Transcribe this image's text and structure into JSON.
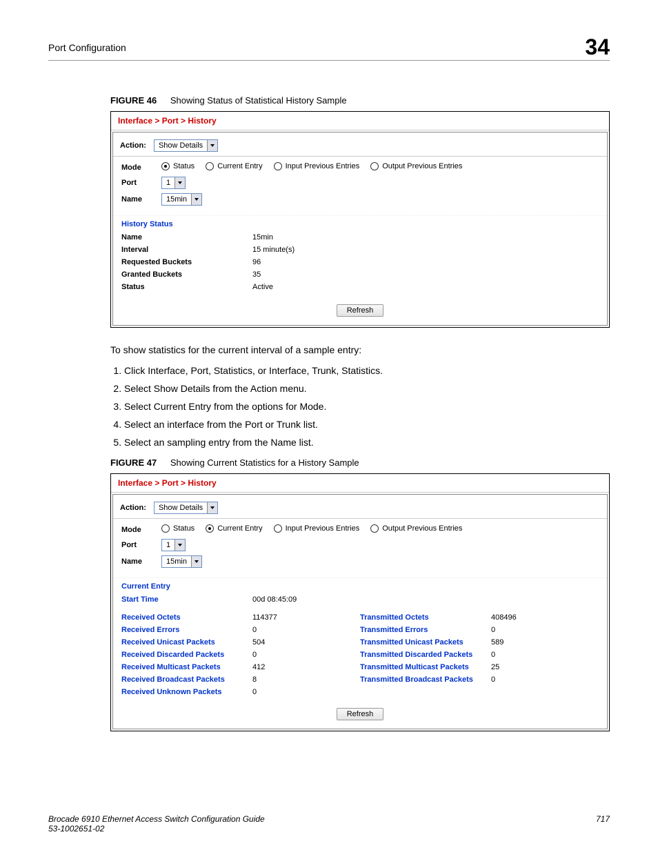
{
  "header": {
    "section": "Port Configuration",
    "chapter": "34"
  },
  "figure46": {
    "label": "FIGURE 46",
    "caption": "Showing Status of Statistical History Sample",
    "breadcrumb": "Interface > Port > History",
    "action_label": "Action:",
    "action_value": "Show Details",
    "mode_label": "Mode",
    "mode_options": [
      "Status",
      "Current Entry",
      "Input Previous Entries",
      "Output Previous Entries"
    ],
    "mode_selected": 0,
    "port_label": "Port",
    "port_value": "1",
    "name_label": "Name",
    "name_value": "15min",
    "section_head": "History Status",
    "rows": [
      {
        "label": "Name",
        "value": "15min"
      },
      {
        "label": "Interval",
        "value": "15 minute(s)"
      },
      {
        "label": "Requested Buckets",
        "value": "96"
      },
      {
        "label": "Granted Buckets",
        "value": "35"
      },
      {
        "label": "Status",
        "value": "Active"
      }
    ],
    "refresh": "Refresh"
  },
  "intro2": "To show statistics for the current interval of a sample entry:",
  "steps": [
    "Click Interface, Port, Statistics, or Interface, Trunk, Statistics.",
    "Select Show Details from the Action menu.",
    "Select Current Entry from the options for Mode.",
    "Select an interface from the Port or Trunk list.",
    "Select an sampling entry from the Name list."
  ],
  "figure47": {
    "label": "FIGURE 47",
    "caption": "Showing Current Statistics for a History Sample",
    "breadcrumb": "Interface > Port > History",
    "action_label": "Action:",
    "action_value": "Show Details",
    "mode_label": "Mode",
    "mode_options": [
      "Status",
      "Current Entry",
      "Input Previous Entries",
      "Output Previous Entries"
    ],
    "mode_selected": 1,
    "port_label": "Port",
    "port_value": "1",
    "name_label": "Name",
    "name_value": "15min",
    "section_head": "Current Entry",
    "start_time_label": "Start Time",
    "start_time_value": "00d 08:45:09",
    "left_stats": [
      {
        "label": "Received Octets",
        "value": "114377"
      },
      {
        "label": "Received Errors",
        "value": "0"
      },
      {
        "label": "Received Unicast Packets",
        "value": "504"
      },
      {
        "label": "Received Discarded Packets",
        "value": "0"
      },
      {
        "label": "Received Multicast Packets",
        "value": "412"
      },
      {
        "label": "Received Broadcast Packets",
        "value": "8"
      },
      {
        "label": "Received Unknown Packets",
        "value": "0"
      }
    ],
    "right_stats": [
      {
        "label": "Transmitted Octets",
        "value": "408496"
      },
      {
        "label": "Transmitted Errors",
        "value": "0"
      },
      {
        "label": "Transmitted Unicast Packets",
        "value": "589"
      },
      {
        "label": "Transmitted Discarded Packets",
        "value": "0"
      },
      {
        "label": "Transmitted Multicast Packets",
        "value": "25"
      },
      {
        "label": "Transmitted Broadcast Packets",
        "value": "0"
      }
    ],
    "refresh": "Refresh"
  },
  "footer": {
    "title": "Brocade 6910 Ethernet Access Switch Configuration Guide",
    "docnum": "53-1002651-02",
    "page": "717"
  }
}
